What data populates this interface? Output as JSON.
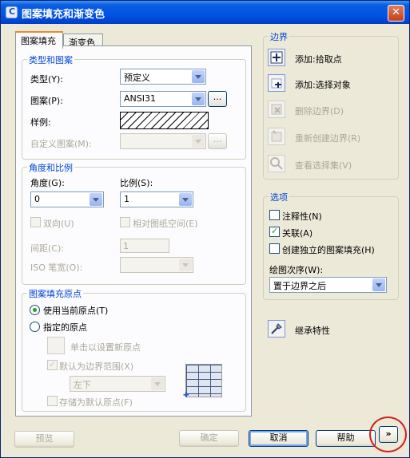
{
  "window": {
    "title": "图案填充和渐变色",
    "close_label": "✕"
  },
  "tabs": [
    {
      "label": "图案填充",
      "active": true
    },
    {
      "label": "渐变色",
      "active": false
    }
  ],
  "type_pattern": {
    "group_title": "类型和图案",
    "type_label": "类型(Y):",
    "type_value": "预定义",
    "pattern_label": "图案(P):",
    "pattern_value": "ANSI31",
    "pattern_browse": "...",
    "sample_label": "样例:",
    "custom_label": "自定义图案(M):",
    "custom_browse": "..."
  },
  "angle_scale": {
    "group_title": "角度和比例",
    "angle_label": "角度(G):",
    "angle_value": "0",
    "scale_label": "比例(S):",
    "scale_value": "1",
    "double_label": "双向(U)",
    "relative_label": "相对图纸空间(E)",
    "spacing_label": "间距(C):",
    "spacing_value": "1",
    "iso_label": "ISO 笔宽(O):"
  },
  "origin": {
    "group_title": "图案填充原点",
    "use_current_label": "使用当前原点(T)",
    "specified_label": "指定的原点",
    "click_set_label": "单击以设置新原点",
    "default_boundary_label": "默认为边界范围(X)",
    "position_value": "左下",
    "store_default_label": "存储为默认原点(F)"
  },
  "boundary": {
    "group_title": "边界",
    "items": [
      {
        "label": "添加:拾取点",
        "icon": "pick-point-icon",
        "enabled": true
      },
      {
        "label": "添加:选择对象",
        "icon": "select-objects-icon",
        "enabled": true
      },
      {
        "label": "删除边界(D)",
        "icon": "remove-boundary-icon",
        "enabled": false
      },
      {
        "label": "重新创建边界(R)",
        "icon": "recreate-boundary-icon",
        "enabled": false
      },
      {
        "label": "查看选择集(V)",
        "icon": "view-selection-icon",
        "enabled": false
      }
    ]
  },
  "options": {
    "group_title": "选项",
    "annotative_label": "注释性(N)",
    "annotative_checked": false,
    "associative_label": "关联(A)",
    "associative_checked": true,
    "separate_label": "创建独立的图案填充(H)",
    "separate_checked": false,
    "draw_order_label": "绘图次序(W):",
    "draw_order_value": "置于边界之后"
  },
  "inherit": {
    "label": "继承特性",
    "icon": "inherit-properties-icon"
  },
  "footer": {
    "preview_label": "预览",
    "ok_label": "确定",
    "cancel_label": "取消",
    "help_label": "帮助",
    "more_label": "»"
  },
  "colors": {
    "accent": "#0046d5",
    "title_bar": "#0054e3",
    "annotation": "#d0201d"
  }
}
